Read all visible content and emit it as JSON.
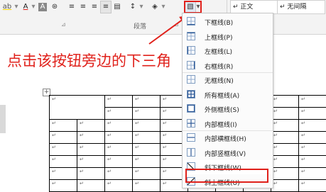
{
  "ribbon": {
    "top_row": {
      "highlight": "ab",
      "font_color": "A",
      "char_shading": "A",
      "enclose": "⊛",
      "para_align": [
        "≡",
        "≡",
        "≡",
        "≡",
        "▤"
      ],
      "line_spacing": "↕",
      "shading": "◈"
    },
    "paragraph_group_label": "段落",
    "styles": [
      {
        "label": "↵ 正文"
      },
      {
        "label": "↵ 无间隔"
      }
    ]
  },
  "annotation": "点击该按钮旁边的下三角",
  "menu": {
    "items": [
      {
        "label": "下框线(B)",
        "icon": "border-bottom-icon"
      },
      {
        "label": "上框线(P)",
        "icon": "border-top-icon"
      },
      {
        "label": "左框线(L)",
        "icon": "border-left-icon"
      },
      {
        "label": "右框线(R)",
        "icon": "border-right-icon"
      },
      {
        "label": "无框线(N)",
        "icon": "no-border-icon"
      },
      {
        "label": "所有框线(A)",
        "icon": "all-borders-icon"
      },
      {
        "label": "外侧框线(S)",
        "icon": "outside-borders-icon"
      },
      {
        "label": "内部框线(I)",
        "icon": "inside-borders-icon"
      },
      {
        "label": "内部横框线(H)",
        "icon": "inside-horizontal-border-icon"
      },
      {
        "label": "内部竖框线(V)",
        "icon": "inside-vertical-border-icon"
      },
      {
        "label": "斜下框线(W)",
        "icon": "diagonal-down-border-icon"
      },
      {
        "label": "斜上框线(U)",
        "icon": "diagonal-up-border-icon"
      }
    ]
  },
  "table": {
    "cell_mark": "↵",
    "handle": "+"
  }
}
